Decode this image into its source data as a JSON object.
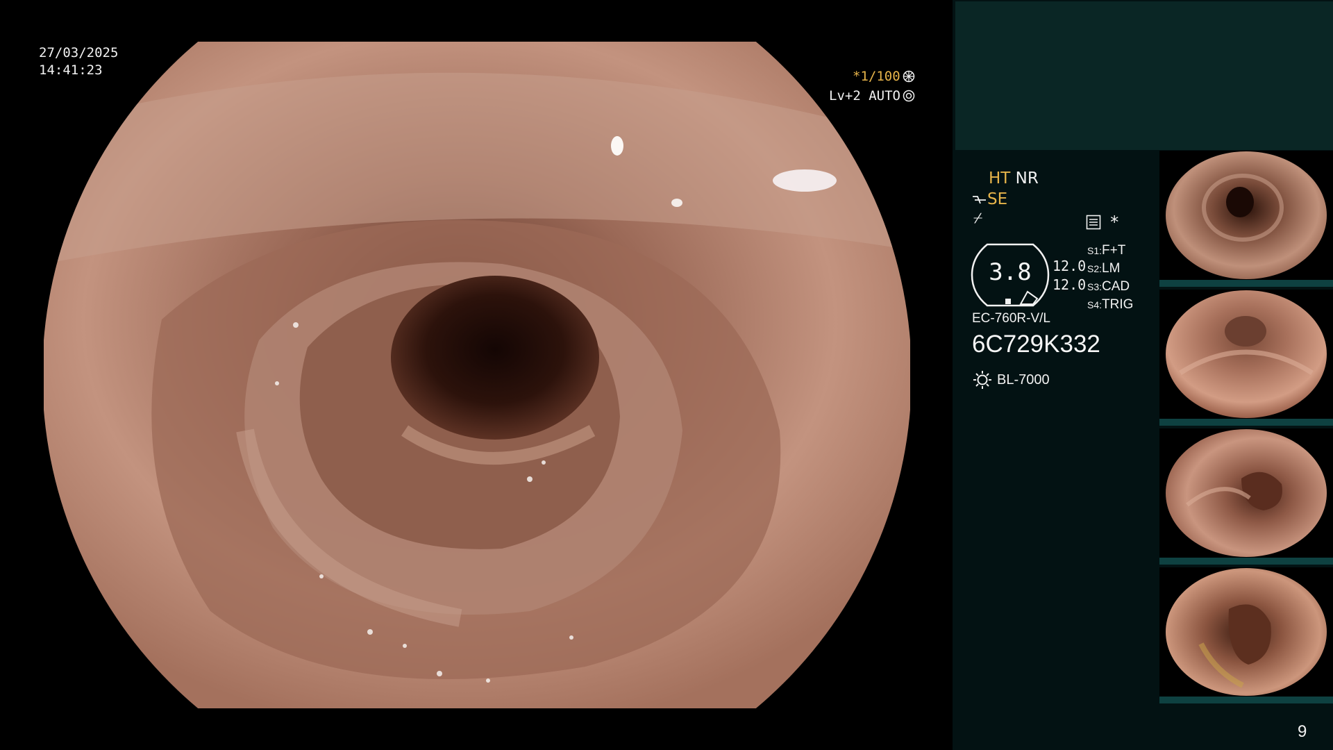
{
  "overlay": {
    "date": "27/03/2025",
    "time": "14:41:23",
    "shutter": "*1/100",
    "agc": "Lv+2 AUTO"
  },
  "status": {
    "ht": "HT",
    "nr": "NR",
    "se": "SE",
    "zoom_value": "3.8",
    "ratio_top": "12.0",
    "ratio_bottom": "12.0",
    "switches": [
      {
        "key": "S1:",
        "value": "F+T"
      },
      {
        "key": "S2:",
        "value": "LM"
      },
      {
        "key": "S3:",
        "value": "CAD"
      },
      {
        "key": "S4:",
        "value": "TRIG"
      }
    ],
    "scope_model": "EC-760R-V/L",
    "scope_serial": "6C729K332",
    "light_source": "BL-7000",
    "image_count": "9"
  },
  "colors": {
    "amber": "#e7b44a",
    "panel_bg": "#031213",
    "panel_top": "#0a2625",
    "thumb_bar": "#0e4141"
  },
  "icons": [
    "shutter-dial-icon",
    "agc-dial-icon",
    "structure-enhance-icon",
    "no-filter-icon",
    "menu-list-icon",
    "asterisk-icon",
    "light-source-icon"
  ]
}
